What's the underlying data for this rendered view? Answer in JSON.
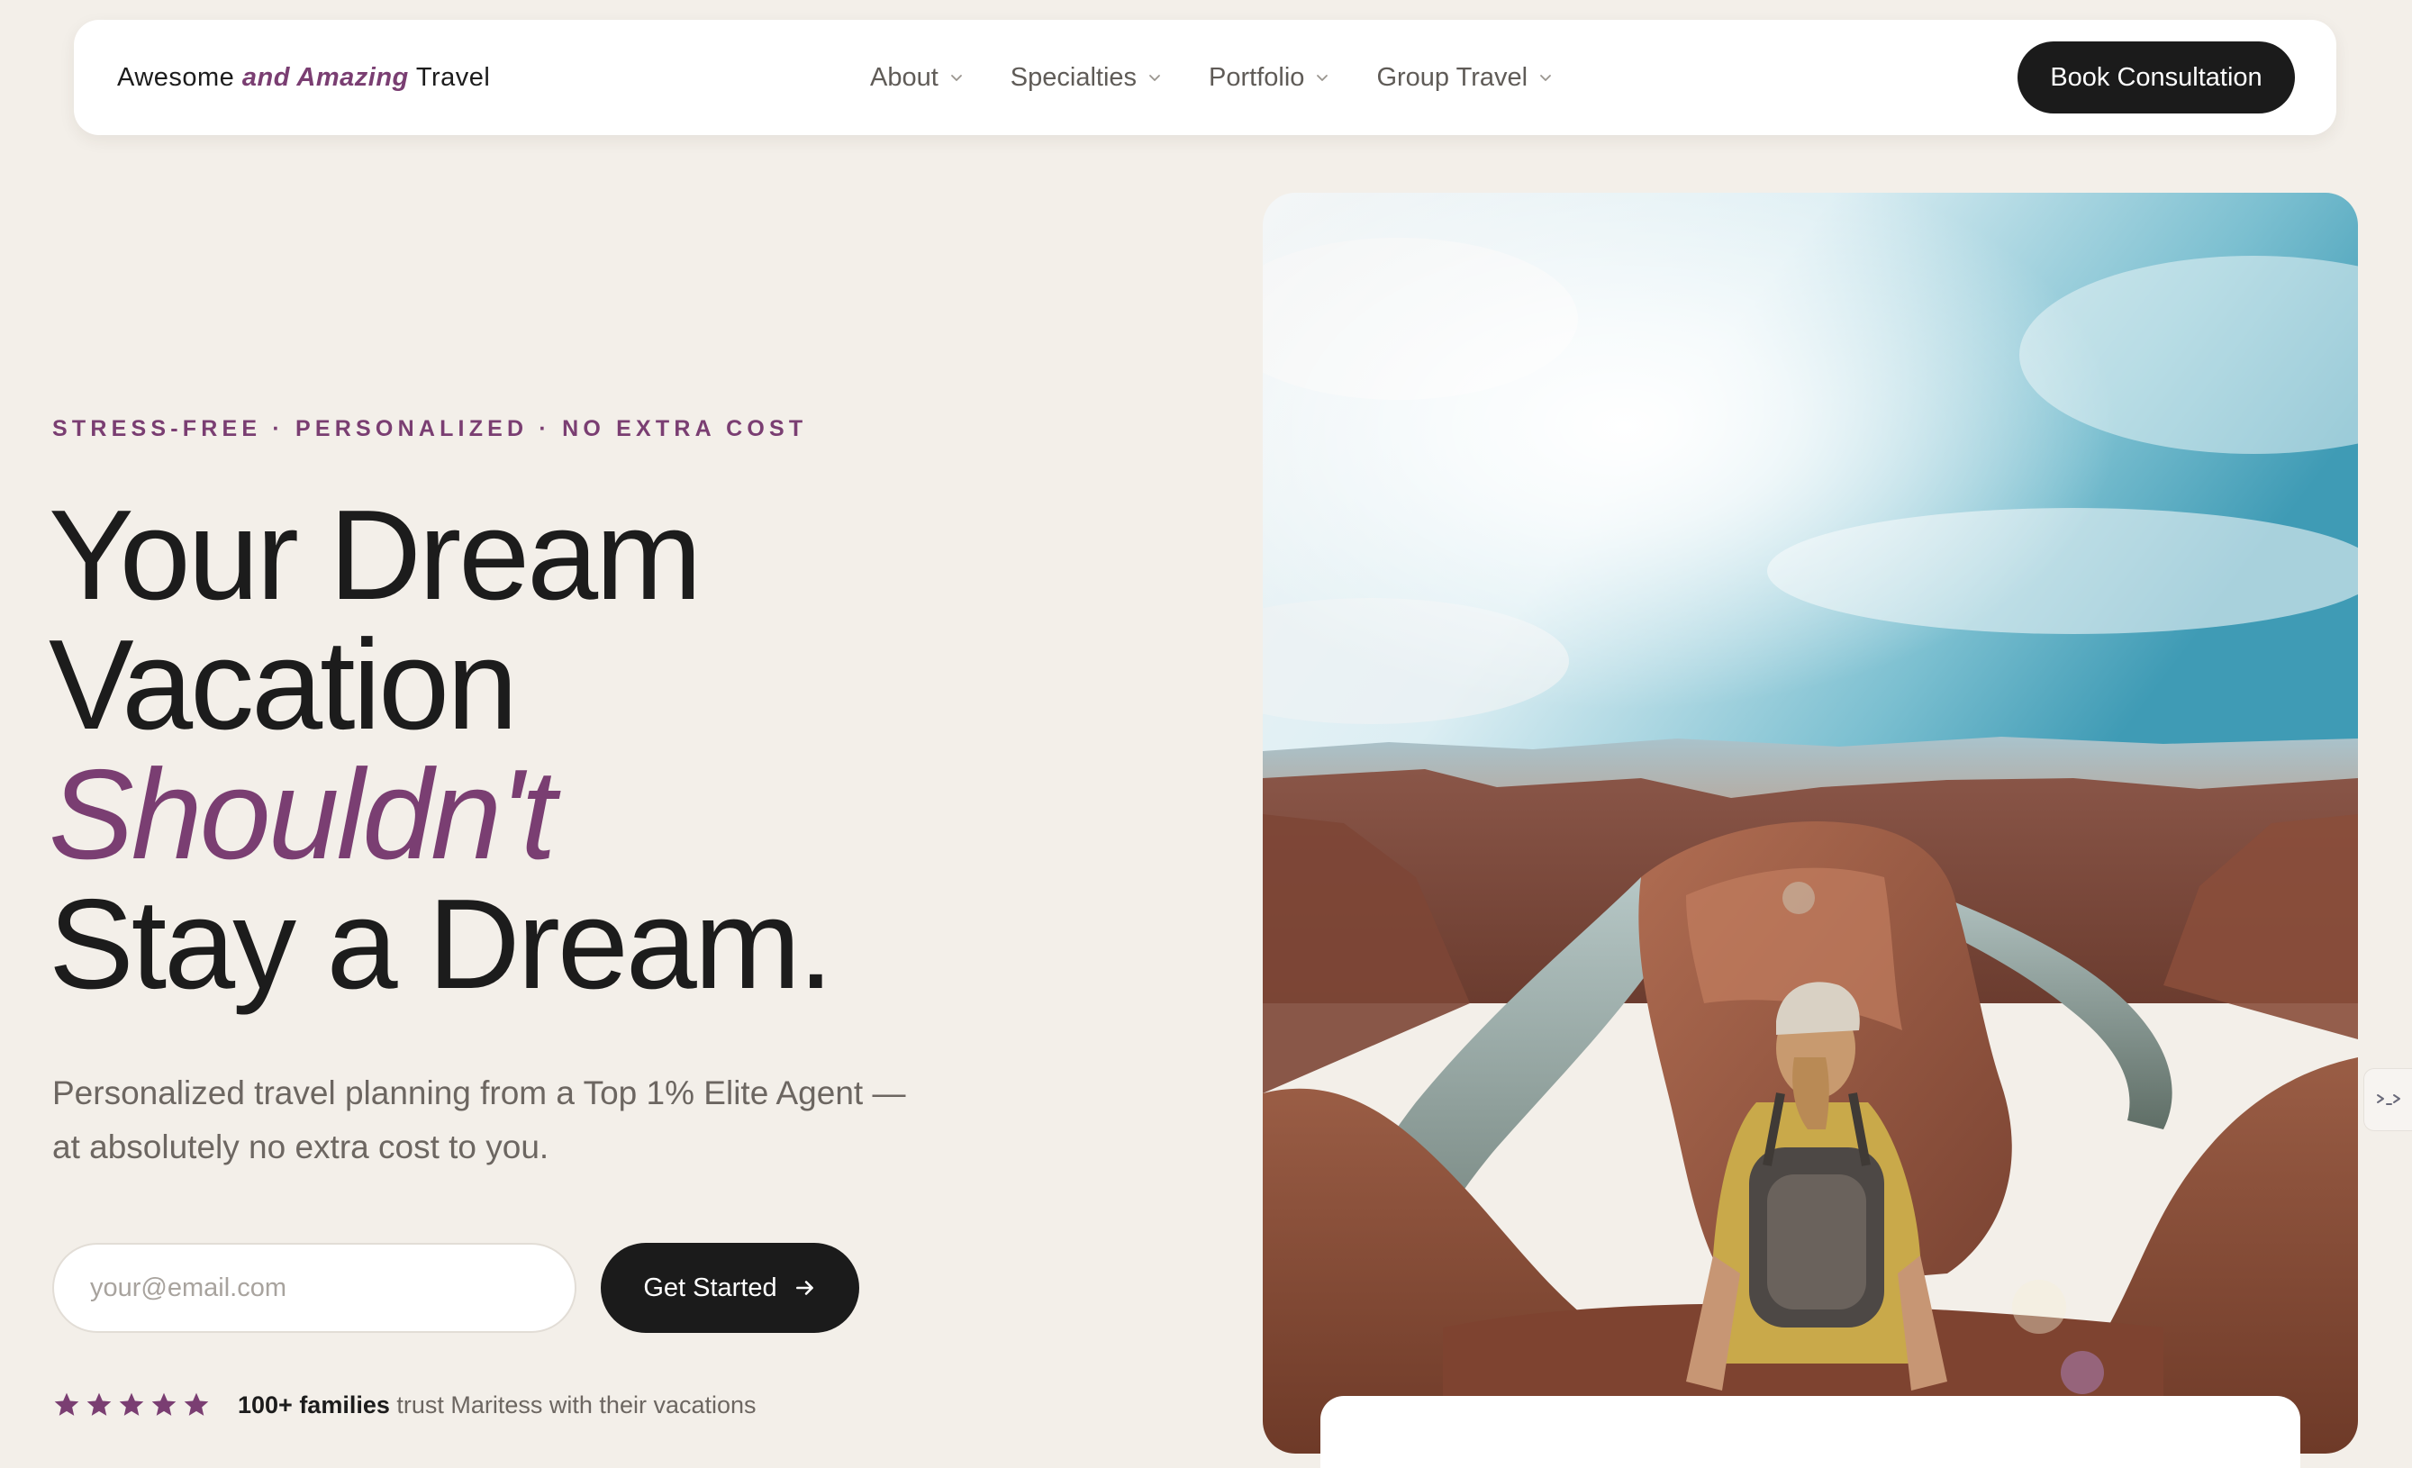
{
  "nav": {
    "brand_prefix": "Awesome",
    "brand_accent": "and Amazing",
    "brand_suffix": "Travel",
    "items": [
      {
        "label": "About"
      },
      {
        "label": "Specialties"
      },
      {
        "label": "Portfolio"
      },
      {
        "label": "Group Travel"
      }
    ],
    "cta_label": "Book Consultation"
  },
  "hero": {
    "eyebrow": "STRESS-FREE · PERSONALIZED · NO EXTRA COST",
    "headline_line1": "Your Dream",
    "headline_line2": "Vacation",
    "headline_accent": "Shouldn't",
    "headline_line4": "Stay a Dream.",
    "subtitle": "Personalized travel planning from a Top 1% Elite Agent — at absolutely no extra cost to you.",
    "email_placeholder": "your@email.com",
    "cta_label": "Get Started",
    "rating_stars": 5,
    "trust_bold": "100+ families",
    "trust_rest": " trust Maritess with their vacations"
  },
  "colors": {
    "accent": "#7a3e72",
    "background": "#f3efe9",
    "button": "#1b1b1b"
  },
  "icons": {
    "nav_chevron": "chevron-down-icon",
    "cta_arrow": "arrow-right-icon",
    "rating": "star-icon",
    "side_tab": "code-icon"
  }
}
